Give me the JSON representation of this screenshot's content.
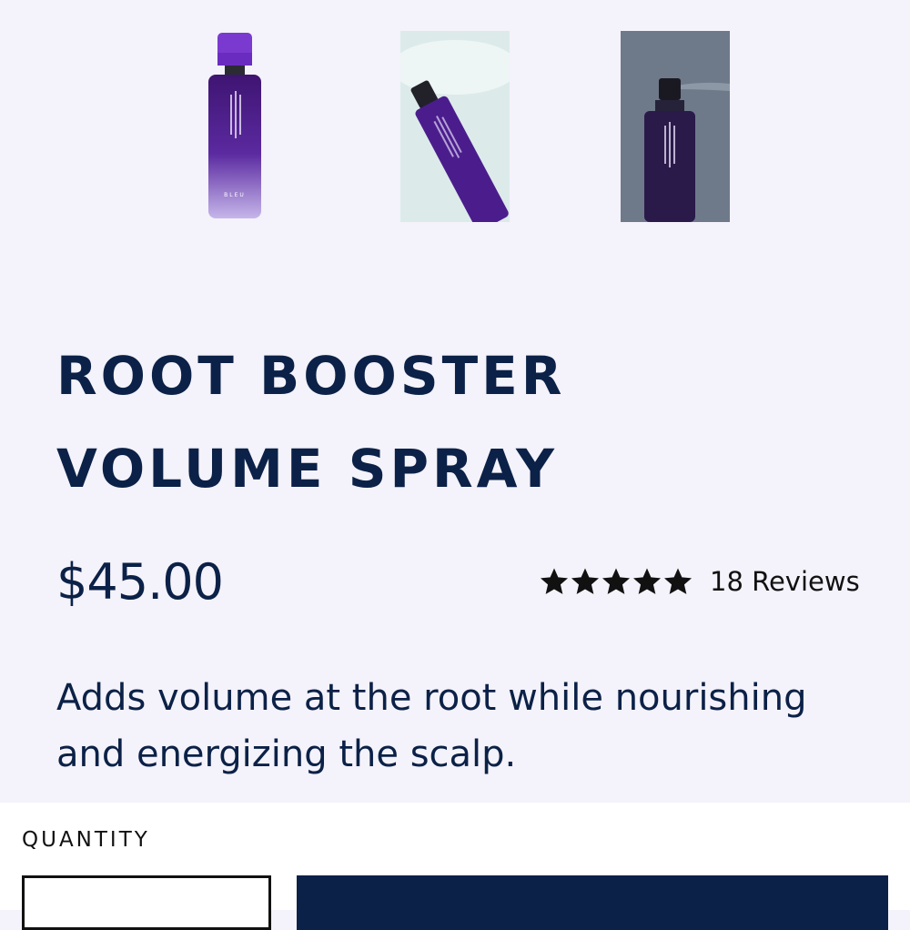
{
  "gallery": {
    "images": [
      {
        "icon": "bottle-product-image"
      },
      {
        "icon": "bottle-lifestyle-image"
      },
      {
        "icon": "bottle-spray-image"
      }
    ]
  },
  "product": {
    "title_line1": "ROOT BOOSTER",
    "title_line2": "VOLUME SPRAY",
    "price": "$45.00",
    "rating": 5,
    "reviews_label": "18 Reviews",
    "description": "Adds volume at the root while nourishing and energizing the scalp."
  },
  "purchase": {
    "quantity_label": "QUANTITY"
  },
  "colors": {
    "brand_navy": "#0b2147",
    "bottle_purple": "#5a2a9a"
  }
}
